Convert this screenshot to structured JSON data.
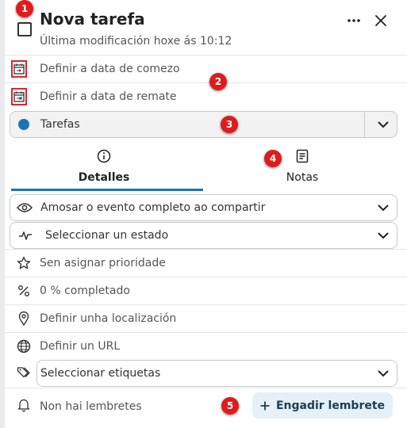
{
  "header": {
    "title": "Nova tarefa",
    "subtitle": "Última modificación hoxe ás 10:12",
    "menu_icon": "more-horizontal-icon",
    "close_icon": "close-icon"
  },
  "dates": {
    "start_label": "Definir a data de comezo",
    "due_label": "Definir a data de remate"
  },
  "calendar": {
    "name": "Tarefas",
    "color": "#1a73b8"
  },
  "tabs": [
    {
      "label": "Detalles",
      "icon": "info-icon",
      "active": true
    },
    {
      "label": "Notas",
      "icon": "notes-icon",
      "active": false
    }
  ],
  "details": {
    "visibility_label": "Amosar o evento completo ao compartir",
    "status_label": "Seleccionar un estado",
    "priority_label": "Sen asignar prioridade",
    "completion_label": "0 % completado",
    "location_label": "Definir unha localización",
    "url_label": "Definir un URL",
    "tags_label": "Seleccionar etiquetas",
    "reminders_label": "Non hai lembretes",
    "add_reminder_label": "Engadir lembrete"
  },
  "annotations": [
    "1",
    "2",
    "3",
    "4",
    "5"
  ],
  "colors": {
    "accent": "#1a73b8",
    "marker": "#e01b1b",
    "highlight_border": "#d9262c"
  }
}
